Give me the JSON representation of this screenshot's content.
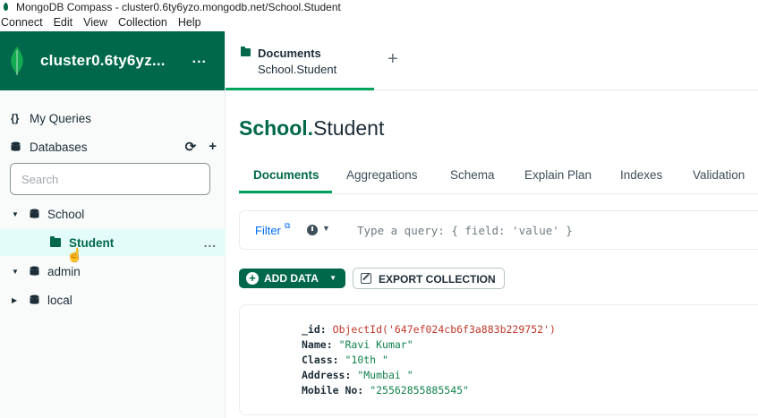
{
  "window": {
    "title": "MongoDB Compass - cluster0.6ty6yzo.mongodb.net/School.Student"
  },
  "menu": [
    "Connect",
    "Edit",
    "View",
    "Collection",
    "Help"
  ],
  "sidebar": {
    "cluster_name": "cluster0.6ty6yz...",
    "more": "...",
    "my_queries": "My Queries",
    "databases_label": "Databases",
    "search_placeholder": "Search",
    "tree": {
      "school": "School",
      "student": "Student",
      "student_more": "...",
      "admin": "admin",
      "local": "local"
    }
  },
  "tabs": {
    "active_title": "Documents",
    "active_namespace": "School.Student",
    "add": "+"
  },
  "main": {
    "db": "School",
    "dot": ".",
    "collection": "Student",
    "subtabs": [
      "Documents",
      "Aggregations",
      "Schema",
      "Explain Plan",
      "Indexes",
      "Validation"
    ],
    "filter_label": "Filter",
    "filter_placeholder": "Type a query: { field: 'value' }",
    "add_data": "ADD DATA",
    "export": "EXPORT COLLECTION"
  },
  "document": {
    "id_key": "_id:",
    "id_value": "ObjectId('647ef024cb6f3a883b229752')",
    "name_key": "Name:",
    "name_value": "\"Ravi Kumar\"",
    "class_key": "Class:",
    "class_value": "\"10th \"",
    "address_key": "Address:",
    "address_value": "\"Mumbai \"",
    "mobile_key": "Mobile No:",
    "mobile_value": "\"25562855885545\""
  },
  "colors": {
    "brand": "#00684a",
    "accent": "#00a35c",
    "link": "#016bf8"
  }
}
